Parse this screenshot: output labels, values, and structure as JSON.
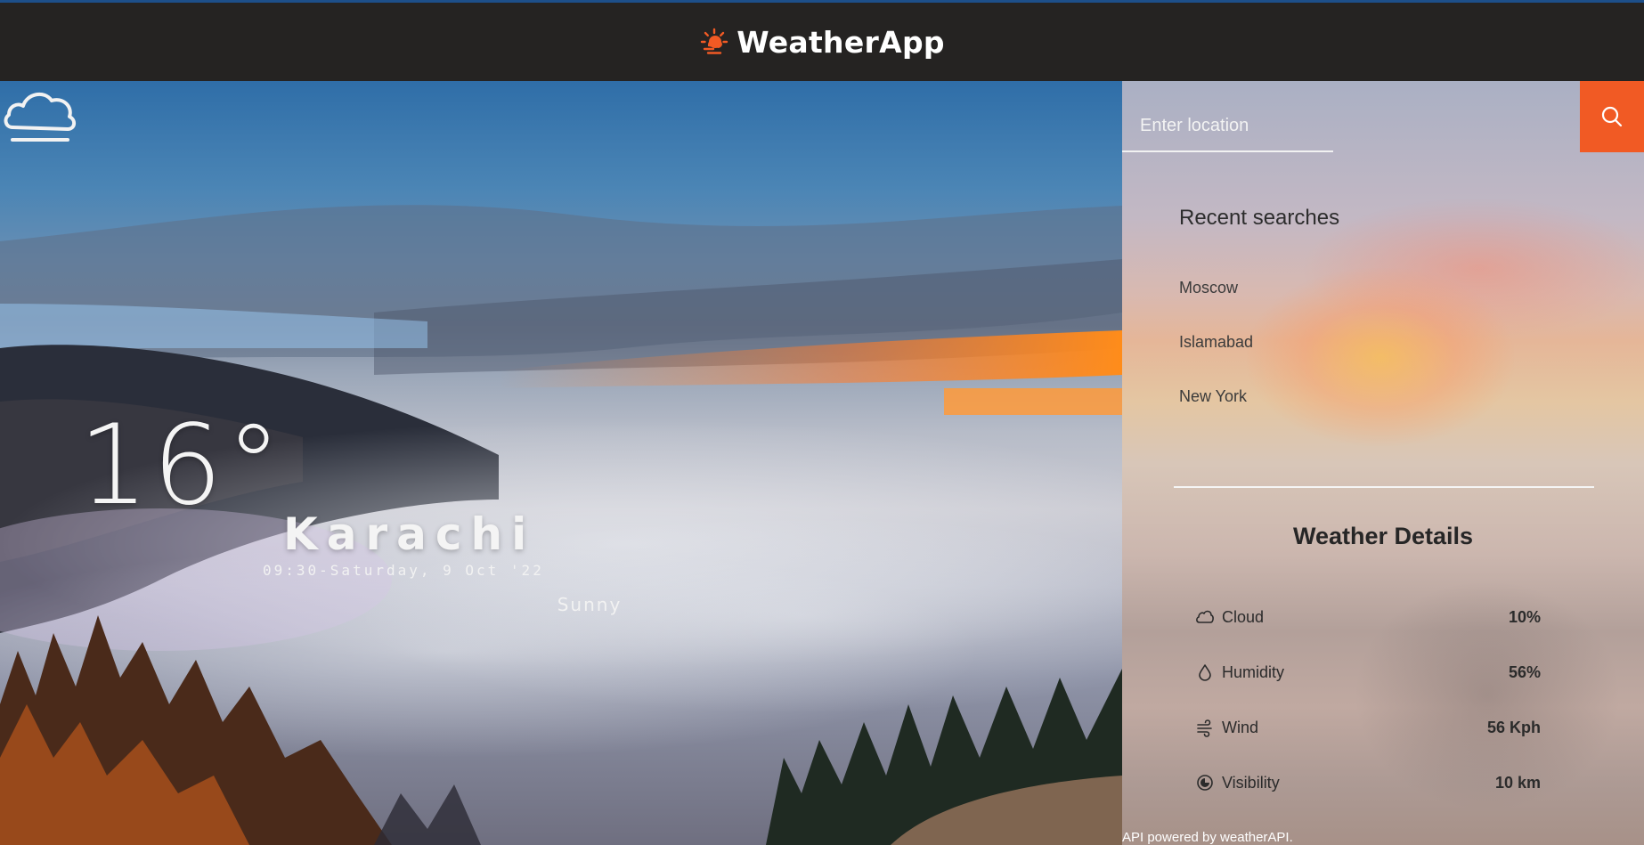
{
  "header": {
    "app_name": "WeatherApp",
    "logo_icon": "sun-horizon-icon",
    "accent_color": "#f15a24"
  },
  "current": {
    "temperature": "16°",
    "city": "Karachi",
    "datetime": "09:30-Saturday, 9 Oct '22",
    "condition": "Sunny",
    "condition_icon": "cloud-icon"
  },
  "search": {
    "placeholder": "Enter location",
    "value": "",
    "button_icon": "search-icon"
  },
  "recent": {
    "title": "Recent searches",
    "items": [
      "Moscow",
      "Islamabad",
      "New York"
    ]
  },
  "details": {
    "title": "Weather Details",
    "rows": [
      {
        "label": "Cloud",
        "value": "10%",
        "icon": "cloud-outline-icon"
      },
      {
        "label": "Humidity",
        "value": "56%",
        "icon": "droplet-icon"
      },
      {
        "label": "Wind",
        "value": "56 Kph",
        "icon": "wind-icon"
      },
      {
        "label": "Visibility",
        "value": "10 km",
        "icon": "visibility-icon"
      }
    ]
  },
  "footer": {
    "text": "API powered by weatherAPI."
  }
}
